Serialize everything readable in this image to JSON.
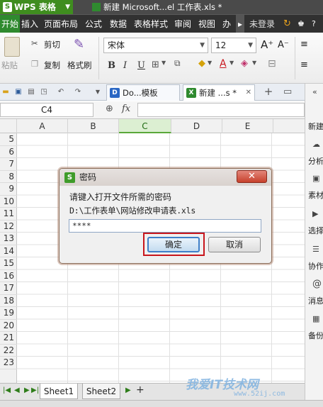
{
  "titlebar": {
    "app_name": "WPS 表格",
    "dropdown": "▼",
    "doc_title": "新建 Microsoft...el 工作表.xls *"
  },
  "menu": {
    "items": [
      "开始",
      "插入",
      "页面布局",
      "公式",
      "数据",
      "表格样式",
      "审阅",
      "视图",
      "办"
    ],
    "more": "▸",
    "login": "未登录"
  },
  "ribbon": {
    "paste": "粘贴",
    "cut": "剪切",
    "copy": "复制",
    "format_painter": "格式刷",
    "font_name": "宋体",
    "font_size": "12",
    "bold": "B",
    "italic": "I",
    "underline": "U"
  },
  "doc_tabs": [
    {
      "label": "Do...模板",
      "icon": "D"
    },
    {
      "label": "新建 ...s *",
      "icon": "X"
    }
  ],
  "formula_bar": {
    "cell_ref": "C4",
    "fx": "fx",
    "zoom_icon": "⊕"
  },
  "columns": [
    "A",
    "B",
    "C",
    "D",
    "E"
  ],
  "rows": [
    "5",
    "6",
    "7",
    "8",
    "9",
    "10",
    "11",
    "12",
    "13",
    "14",
    "15",
    "16",
    "17",
    "18",
    "19",
    "20",
    "21",
    "22",
    "23"
  ],
  "right_panel": [
    "新建",
    "分析",
    "素材",
    "选择",
    "协作",
    "消息",
    "备份"
  ],
  "sheets": {
    "tabs": [
      "Sheet1",
      "Sheet2"
    ],
    "add": "+"
  },
  "dialog": {
    "title": "密码",
    "close": "✕",
    "prompt": "请键入打开文件所需的密码",
    "path": "D:\\工作表单\\网站修改申请表.xls",
    "password_value": "****",
    "ok": "确定",
    "cancel": "取消"
  },
  "watermark": {
    "text": "我爱IT技术网",
    "url": "www.52ij.com"
  },
  "colors": {
    "brand": "#3f8d1f",
    "highlight_box": "#c8161d",
    "close_button": "#c7412c"
  }
}
